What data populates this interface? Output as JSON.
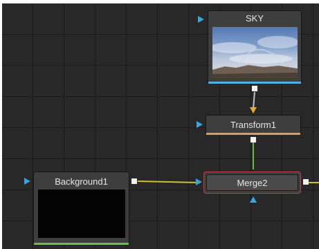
{
  "nodes": {
    "sky": {
      "label": "SKY"
    },
    "transform": {
      "label": "Transform1"
    },
    "background": {
      "label": "Background1"
    },
    "merge": {
      "label": "Merge2"
    }
  },
  "colors": {
    "canvas_bg": "#282828",
    "grid": "#1b1b1b",
    "input_triangle": "#3aa5e0",
    "foreground_triangle": "#e0b41e",
    "wire_yellow": "#d8be2e",
    "wire_green": "#6bbf3c",
    "merge_selected_border": "#c0403a",
    "sky_bar": "#5aaee0",
    "transform_bar": "#caa276",
    "background_bar": "#6bbf3c"
  }
}
